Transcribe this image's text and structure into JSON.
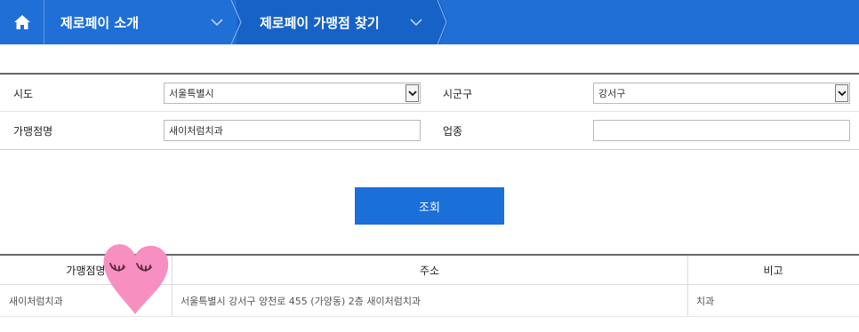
{
  "nav": {
    "crumb1_label": "제로페이 소개",
    "crumb2_label": "제로페이 가맹점 찾기"
  },
  "form": {
    "sido_label": "시도",
    "sido_value": "서울특별시",
    "sigungu_label": "시군구",
    "sigungu_value": "강서구",
    "store_label": "가맹점명",
    "store_value": "새이처럼치과",
    "category_label": "업종",
    "category_value": ""
  },
  "search": {
    "button_label": "조회"
  },
  "results": {
    "headers": [
      "가맹점명",
      "주소",
      "비고"
    ],
    "rows": [
      [
        "새이처럼치과",
        "서울특별시 강서구 양천로 455 (가양동) 2층 새이처럼치과",
        "치과"
      ]
    ]
  },
  "colors": {
    "nav_bg": "#1f6fd6",
    "button_bg": "#1b6fd8",
    "sticker": "#f78fc0"
  }
}
